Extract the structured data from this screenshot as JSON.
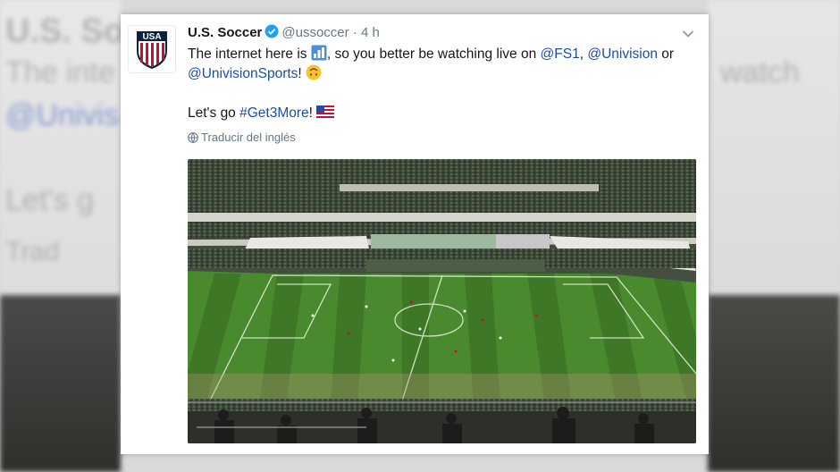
{
  "background": {
    "line1": "U.S. So",
    "line2": "The inte",
    "line2_right": "watch",
    "line3": "@Univis",
    "line4": "Let's g",
    "line5": "Trad"
  },
  "tweet": {
    "display_name": "U.S. Soccer",
    "handle": "@ussoccer",
    "separator": "·",
    "time": "4 h",
    "text_part1": "The internet here is ",
    "text_part2": ", so you better be watching live on ",
    "mention_fs1": "@FS1",
    "comma": ", ",
    "mention_univision": "@Univision",
    "or": " or",
    "mention_univision_sports": "@UnivisionSports",
    "exclaim": "! ",
    "lets_go": "Let's go ",
    "hashtag": "#Get3More",
    "bang": "! ",
    "translate_label": "Traducir del inglés",
    "avatar_text": "USA",
    "icons": {
      "verified": "verified-badge-icon",
      "chevron": "chevron-down-icon",
      "chart": "bar-chart-emoji-icon",
      "upside": "upside-down-face-emoji-icon",
      "flag": "us-flag-emoji-icon",
      "globe": "globe-icon"
    },
    "colors": {
      "link": "#1b4ea3",
      "verified": "#1da1f2",
      "pitch": "#4a8a2e",
      "crest_red": "#c8102e",
      "crest_navy": "#0a2240"
    }
  }
}
